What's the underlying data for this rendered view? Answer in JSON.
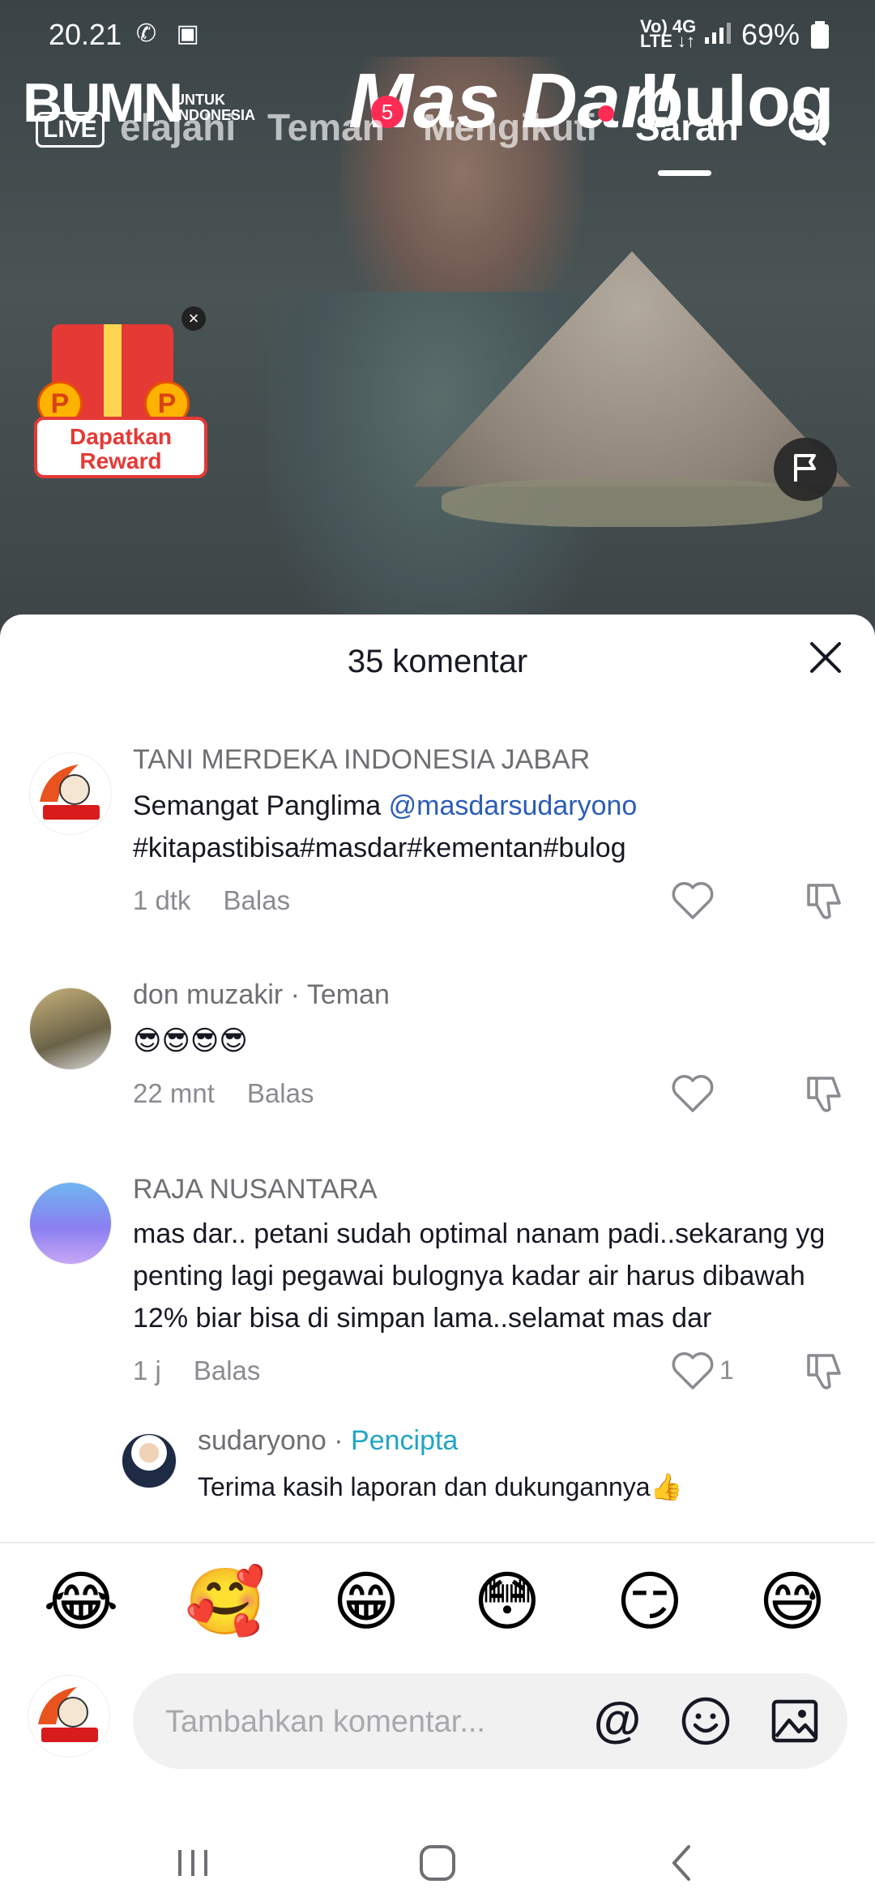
{
  "status_bar": {
    "time": "20.21",
    "notif_icons": "✆ ▣",
    "network_top": "Vo) 4G",
    "network_bottom": "LTE ↓↑",
    "battery": "69%"
  },
  "top_nav": {
    "live_label": "LIVE",
    "tabs": [
      {
        "label": "elajahi"
      },
      {
        "label": "Teman"
      },
      {
        "label": "Mengikuti"
      },
      {
        "label": "Saran",
        "active": true
      }
    ]
  },
  "video_overlay": {
    "logo_left": "BUMN",
    "logo_left_sub": "UNTUK INDONESIA",
    "logo_center": "Mas Dar!",
    "logo_center_badge": "5",
    "logo_right": "bulog"
  },
  "reward": {
    "coin_letter": "P",
    "label": "Dapatkan Reward"
  },
  "sheet": {
    "title": "35 komentar",
    "comments": [
      {
        "author": "TANI MERDEKA INDONESIA JABAR",
        "text_prefix": "Semangat Panglima ",
        "mention": "@masdarsudaryono",
        "text_line2": "#kitapastibisa#masdar#kementan#bulog",
        "time": "1 dtk",
        "reply_label": "Balas",
        "avatar_text": "TANI MERDEKA INDONESIA"
      },
      {
        "author": "don muzakir",
        "tag": "Teman",
        "text": "😎😎😎😎",
        "time": "22 mnt",
        "reply_label": "Balas"
      },
      {
        "author": "RAJA NUSANTARA",
        "text": "mas dar.. petani sudah optimal nanam padi..sekarang yg penting lagi pegawai bulognya kadar air harus dibawah 12% biar bisa di simpan lama..selamat mas dar",
        "time": "1 j",
        "reply_label": "Balas",
        "likes": "1"
      }
    ],
    "reply": {
      "author": "sudaryono",
      "tag": "Pencipta",
      "text": "Terima kasih laporan dan dukungannya👍"
    }
  },
  "quick_emojis": [
    "😂",
    "🥰",
    "😁",
    "😳",
    "😏",
    "😅"
  ],
  "composer": {
    "placeholder": "Tambahkan komentar...",
    "at_symbol": "@",
    "avatar_text": "TANI MERDEKA INDONESIA"
  },
  "colors": {
    "accent": "#fe2c55",
    "mention": "#2b5db8",
    "creator": "#20a5c6"
  }
}
